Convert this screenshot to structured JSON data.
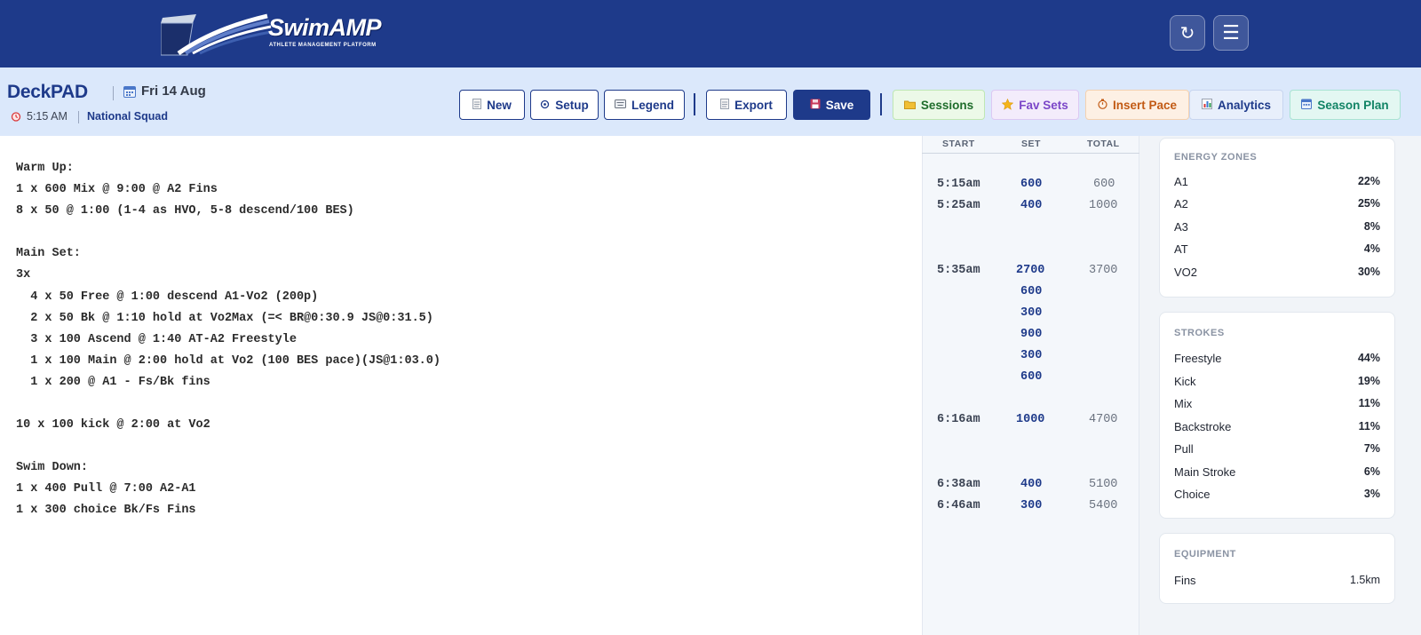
{
  "brand": {
    "logo_text": "SwimAMP",
    "logo_tagline": "ATHLETE MANAGEMENT PLATFORM"
  },
  "header": {
    "refresh_icon": "↻",
    "menu_icon": "☰"
  },
  "session": {
    "app_name": "DeckPAD",
    "date": "Fri 14 Aug",
    "time": "5:15 AM",
    "squad": "National Squad"
  },
  "toolbar": {
    "new_label": "New",
    "setup_label": "Setup",
    "legend_label": "Legend",
    "export_label": "Export",
    "save_label": "Save",
    "sessions_label": "Sessions",
    "fav_sets_label": "Fav Sets",
    "insert_pace_label": "Insert Pace",
    "analytics_label": "Analytics",
    "season_plan_label": "Season Plan"
  },
  "editor": {
    "lines": [
      "Warm Up:",
      "1 x 600 Mix @ 9:00 @ A2 Fins",
      "8 x 50 @ 1:00 (1-4 as HVO, 5-8 descend/100 BES)",
      "",
      "Main Set:",
      "3x",
      "  4 x 50 Free @ 1:00 descend A1-Vo2 (200p)",
      "  2 x 50 Bk @ 1:10 hold at Vo2Max (=< BR@0:30.9 JS@0:31.5)",
      "  3 x 100 Ascend @ 1:40 AT-A2 Freestyle",
      "  1 x 100 Main @ 2:00 hold at Vo2 (100 BES pace)(JS@1:03.0)",
      "  1 x 200 @ A1 - Fs/Bk fins",
      "",
      "10 x 100 kick @ 2:00 at Vo2",
      "",
      "Swim Down:",
      "1 x 400 Pull @ 7:00 A2-A1",
      "1 x 300 choice Bk/Fs Fins"
    ]
  },
  "timing": {
    "headers": {
      "start": "START",
      "set": "SET",
      "total": "TOTAL"
    },
    "rows": [
      {
        "start": "5:15am",
        "set": "600",
        "total": "600"
      },
      {
        "start": "5:25am",
        "set": "400",
        "total": "1000"
      },
      {
        "start": "5:35am",
        "set": "2700",
        "total": "3700"
      },
      {
        "start": "",
        "set": "600",
        "total": ""
      },
      {
        "start": "",
        "set": "300",
        "total": ""
      },
      {
        "start": "",
        "set": "900",
        "total": ""
      },
      {
        "start": "",
        "set": "300",
        "total": ""
      },
      {
        "start": "",
        "set": "600",
        "total": ""
      },
      {
        "start": "6:16am",
        "set": "1000",
        "total": "4700"
      },
      {
        "start": "6:38am",
        "set": "400",
        "total": "5100"
      },
      {
        "start": "6:46am",
        "set": "300",
        "total": "5400"
      }
    ]
  },
  "energy_zones": {
    "title": "ENERGY ZONES",
    "items": [
      {
        "label": "A1",
        "value": "22%"
      },
      {
        "label": "A2",
        "value": "25%"
      },
      {
        "label": "A3",
        "value": "8%"
      },
      {
        "label": "AT",
        "value": "4%"
      },
      {
        "label": "VO2",
        "value": "30%"
      }
    ]
  },
  "strokes": {
    "title": "STROKES",
    "items": [
      {
        "label": "Freestyle",
        "value": "44%"
      },
      {
        "label": "Kick",
        "value": "19%"
      },
      {
        "label": "Mix",
        "value": "11%"
      },
      {
        "label": "Backstroke",
        "value": "11%"
      },
      {
        "label": "Pull",
        "value": "7%"
      },
      {
        "label": "Main Stroke",
        "value": "6%"
      },
      {
        "label": "Choice",
        "value": "3%"
      }
    ]
  },
  "equipment": {
    "title": "EQUIPMENT",
    "items": [
      {
        "label": "Fins",
        "value": "1.5km"
      }
    ]
  },
  "colors": {
    "header_bg": "#1e3a8a",
    "toolbar_bg": "#dbe8fb",
    "primary": "#1e3a8a"
  }
}
